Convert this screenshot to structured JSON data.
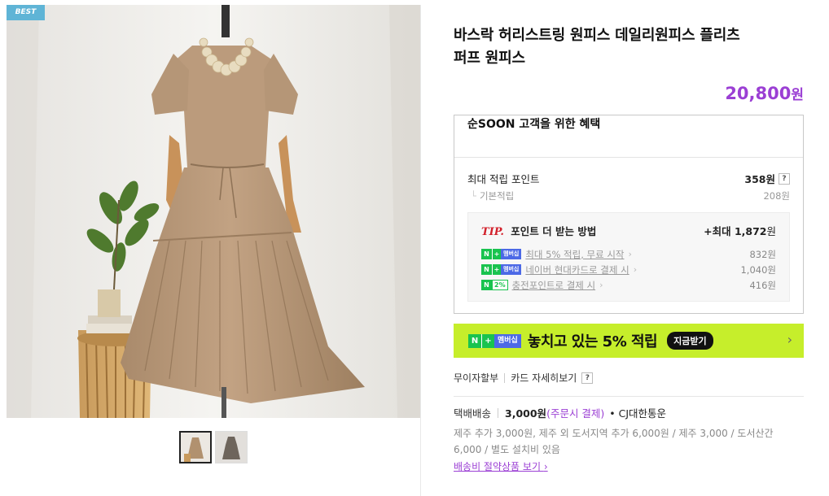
{
  "gallery": {
    "badge": "BEST",
    "thumbnail_count": 2,
    "active_thumbnail": 1
  },
  "product": {
    "title_line1": "바스락 허리스트링 원피스 데일리원피스 플리츠",
    "title_line2": "퍼프 원피스",
    "price": "20,800",
    "price_unit": "원"
  },
  "benefits": {
    "header": "순SOON 고객을 위한 혜택",
    "max_points_label": "최대 적립 포인트",
    "max_points_value": "358원",
    "base_points_label": "기본적립",
    "base_points_value": "208원",
    "tip": {
      "label": "TIP.",
      "title": "포인트 더 받는 방법",
      "max_label": "+최대",
      "max_value": "1,872",
      "max_unit": "원",
      "items": [
        {
          "badge": "membership",
          "text": "최대 5% 적립, 무료 시작",
          "value": "832원"
        },
        {
          "badge": "membership",
          "text": "네이버 현대카드로 결제 시",
          "value": "1,040원"
        },
        {
          "badge": "pay2",
          "text": "충전포인트로 결제 시",
          "value": "416원"
        }
      ]
    }
  },
  "badges": {
    "n": "N",
    "plus": "+",
    "membership": "멤버십",
    "pay_pct": "2%"
  },
  "banner": {
    "text": "놓치고 있는 5% 적립",
    "button": "지금받기",
    "bg_color": "#c6ee2b"
  },
  "pay_links": {
    "installment": "무이자할부",
    "card_detail": "카드 자세히보기",
    "help": "?"
  },
  "shipping": {
    "method": "택배배송",
    "fee": "3,000원",
    "condition": "(주문시 결제)",
    "carrier": "• CJ대한통운",
    "note_line1": "제주 추가 3,000원, 제주 외 도서지역 추가 6,000원 / 제주 3,000 / 도서산간",
    "note_line2": "6,000 / 별도 설치비 있음",
    "save_link": "배송비 절약상품 보기"
  },
  "colors": {
    "accent": "#9b3fd4",
    "tip_red": "#d2202b",
    "naver_green": "#19c34f",
    "best_badge": "#5fb4d6"
  },
  "icons": [
    "dress-photo",
    "help-icon",
    "chevron-right-icon",
    "naver-n-icon"
  ]
}
